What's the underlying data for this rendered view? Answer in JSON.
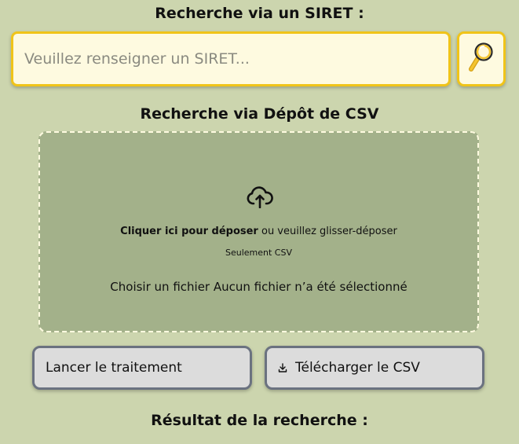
{
  "siret_section": {
    "title": "Recherche via un SIRET :",
    "input_placeholder": "Veuillez renseigner un SIRET...",
    "input_value": "",
    "search_icon": "magnifier-icon"
  },
  "csv_section": {
    "title": "Recherche via Dépôt de CSV",
    "upload_icon": "cloud-upload-icon",
    "click_label": "Cliquer ici pour déposer",
    "drag_label": "ou veuillez glisser-déposer",
    "only_csv": "Seulement CSV",
    "file_choose_label": "Choisir un fichier",
    "file_status": "Aucun fichier n’a été sélectionné"
  },
  "actions": {
    "run_label": "Lancer le traitement",
    "download_label": "Télécharger le CSV",
    "download_icon": "download-icon"
  },
  "result_section": {
    "title": "Résultat de la recherche :"
  },
  "colors": {
    "background": "#ccd5ae",
    "input_bg": "#fefae0",
    "accent_border": "#f0c419",
    "dropzone_bg": "#a3b18a",
    "button_bg": "#dcdcdc",
    "button_border": "#6b7280"
  }
}
